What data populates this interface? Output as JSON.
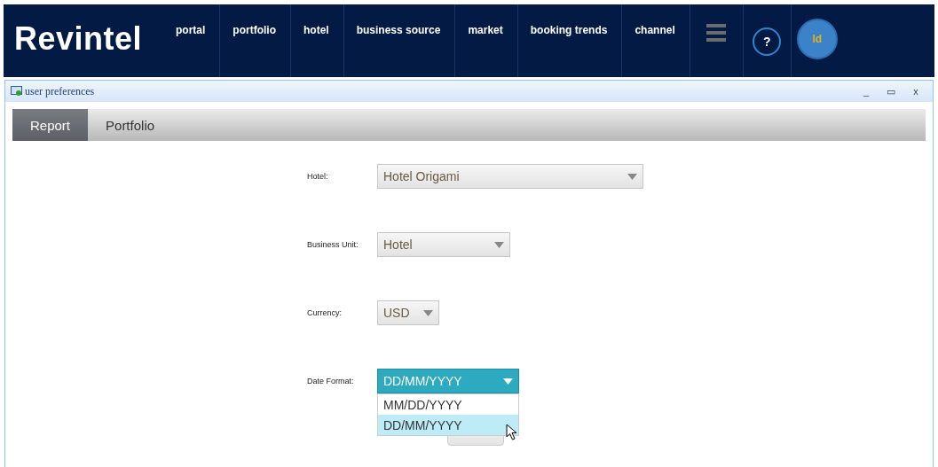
{
  "header": {
    "logo": "Revintel",
    "nav": [
      {
        "label": "portal",
        "selected": false
      },
      {
        "label": "portfolio",
        "selected": false
      },
      {
        "label": "hotel",
        "selected": false
      },
      {
        "label": "business source",
        "selected": false
      },
      {
        "label": "market",
        "selected": false
      },
      {
        "label": "booking trends",
        "selected": false
      },
      {
        "label": "channel",
        "selected": false
      }
    ],
    "help": "?",
    "avatar": "ld"
  },
  "window": {
    "title": "user preferences",
    "controls": [
      "_",
      "▭",
      "x"
    ]
  },
  "tabs": [
    {
      "label": "Report",
      "selected": true
    },
    {
      "label": "Portfolio",
      "selected": false
    }
  ],
  "form": [
    {
      "label": "Hotel:",
      "value": "Hotel Origami",
      "expanded": false
    },
    {
      "label": "Business Unit:",
      "value": "Hotel",
      "expanded": false
    },
    {
      "label": "Currency:",
      "value": "USD",
      "expanded": false
    },
    {
      "label": "Date Format:",
      "value": "DD/MM/YYYY",
      "expanded": true,
      "options": [
        {
          "label": "MM/DD/YYYY",
          "selected": false
        },
        {
          "label": "DD/MM/YYYY",
          "selected": true
        }
      ]
    }
  ]
}
